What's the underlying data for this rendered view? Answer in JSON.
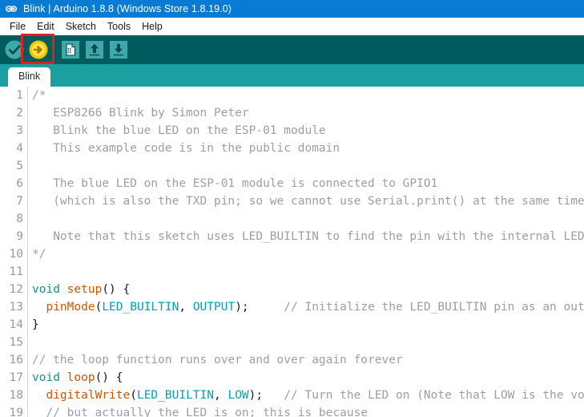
{
  "window": {
    "title": "Blink | Arduino 1.8.8 (Windows Store 1.8.19.0)",
    "logo_icon": "arduino-infinity-icon",
    "titlebar_color": "#0a7bd4"
  },
  "menubar": {
    "items": [
      {
        "label": "File"
      },
      {
        "label": "Edit"
      },
      {
        "label": "Sketch"
      },
      {
        "label": "Tools"
      },
      {
        "label": "Help"
      }
    ]
  },
  "toolbar": {
    "background_color": "#005c5f",
    "buttons": [
      {
        "name": "verify-button",
        "icon": "checkmark-icon",
        "tooltip": "Verify"
      },
      {
        "name": "upload-button",
        "icon": "right-arrow-icon",
        "tooltip": "Upload",
        "highlighted": true
      },
      {
        "name": "new-button",
        "icon": "new-document-icon",
        "tooltip": "New"
      },
      {
        "name": "open-button",
        "icon": "up-arrow-icon",
        "tooltip": "Open"
      },
      {
        "name": "save-button",
        "icon": "down-arrow-icon",
        "tooltip": "Save"
      }
    ],
    "annotation_color": "#e02020"
  },
  "tabs": {
    "background_color": "#1aa0a0",
    "items": [
      {
        "label": "Blink",
        "active": true
      }
    ]
  },
  "editor": {
    "lines": [
      {
        "n": "1",
        "tokens": [
          {
            "t": "/*",
            "c": "c-comment"
          }
        ]
      },
      {
        "n": "2",
        "tokens": [
          {
            "t": "   ESP8266 Blink by Simon Peter",
            "c": "c-comment"
          }
        ]
      },
      {
        "n": "3",
        "tokens": [
          {
            "t": "   Blink the blue LED on the ESP-01 module",
            "c": "c-comment"
          }
        ]
      },
      {
        "n": "4",
        "tokens": [
          {
            "t": "   This example code is in the public domain",
            "c": "c-comment"
          }
        ]
      },
      {
        "n": "5",
        "tokens": [
          {
            "t": "",
            "c": "c-comment"
          }
        ]
      },
      {
        "n": "6",
        "tokens": [
          {
            "t": "   The blue LED on the ESP-01 module is connected to GPIO1",
            "c": "c-comment"
          }
        ]
      },
      {
        "n": "7",
        "tokens": [
          {
            "t": "   (which is also the TXD pin; so we cannot use Serial.print() at the same time)",
            "c": "c-comment"
          }
        ]
      },
      {
        "n": "8",
        "tokens": [
          {
            "t": "",
            "c": "c-comment"
          }
        ]
      },
      {
        "n": "9",
        "tokens": [
          {
            "t": "   Note that this sketch uses LED_BUILTIN to find the pin with the internal LED",
            "c": "c-comment"
          }
        ]
      },
      {
        "n": "10",
        "tokens": [
          {
            "t": "*/",
            "c": "c-comment"
          }
        ]
      },
      {
        "n": "11",
        "tokens": [
          {
            "t": "",
            "c": "c-plain"
          }
        ]
      },
      {
        "n": "12",
        "tokens": [
          {
            "t": "void",
            "c": "c-keyword"
          },
          {
            "t": " ",
            "c": "c-plain"
          },
          {
            "t": "setup",
            "c": "c-func"
          },
          {
            "t": "() {",
            "c": "c-plain"
          }
        ]
      },
      {
        "n": "13",
        "tokens": [
          {
            "t": "  ",
            "c": "c-plain"
          },
          {
            "t": "pinMode",
            "c": "c-func"
          },
          {
            "t": "(",
            "c": "c-plain"
          },
          {
            "t": "LED_BUILTIN",
            "c": "c-const"
          },
          {
            "t": ", ",
            "c": "c-plain"
          },
          {
            "t": "OUTPUT",
            "c": "c-const"
          },
          {
            "t": ");",
            "c": "c-plain"
          },
          {
            "t": "     // Initialize the LED_BUILTIN pin as an output",
            "c": "c-comment"
          }
        ]
      },
      {
        "n": "14",
        "tokens": [
          {
            "t": "}",
            "c": "c-plain"
          }
        ]
      },
      {
        "n": "15",
        "tokens": [
          {
            "t": "",
            "c": "c-plain"
          }
        ]
      },
      {
        "n": "16",
        "tokens": [
          {
            "t": "// the loop function runs over and over again forever",
            "c": "c-comment"
          }
        ]
      },
      {
        "n": "17",
        "tokens": [
          {
            "t": "void",
            "c": "c-keyword"
          },
          {
            "t": " ",
            "c": "c-plain"
          },
          {
            "t": "loop",
            "c": "c-func"
          },
          {
            "t": "() {",
            "c": "c-plain"
          }
        ]
      },
      {
        "n": "18",
        "tokens": [
          {
            "t": "  ",
            "c": "c-plain"
          },
          {
            "t": "digitalWrite",
            "c": "c-func"
          },
          {
            "t": "(",
            "c": "c-plain"
          },
          {
            "t": "LED_BUILTIN",
            "c": "c-const"
          },
          {
            "t": ", ",
            "c": "c-plain"
          },
          {
            "t": "LOW",
            "c": "c-const"
          },
          {
            "t": ");",
            "c": "c-plain"
          },
          {
            "t": "   // Turn the LED on (Note that LOW is the voltage level",
            "c": "c-comment"
          }
        ]
      },
      {
        "n": "19",
        "tokens": [
          {
            "t": "  // but actually the LED is on; this is because",
            "c": "c-comment"
          }
        ]
      }
    ]
  }
}
